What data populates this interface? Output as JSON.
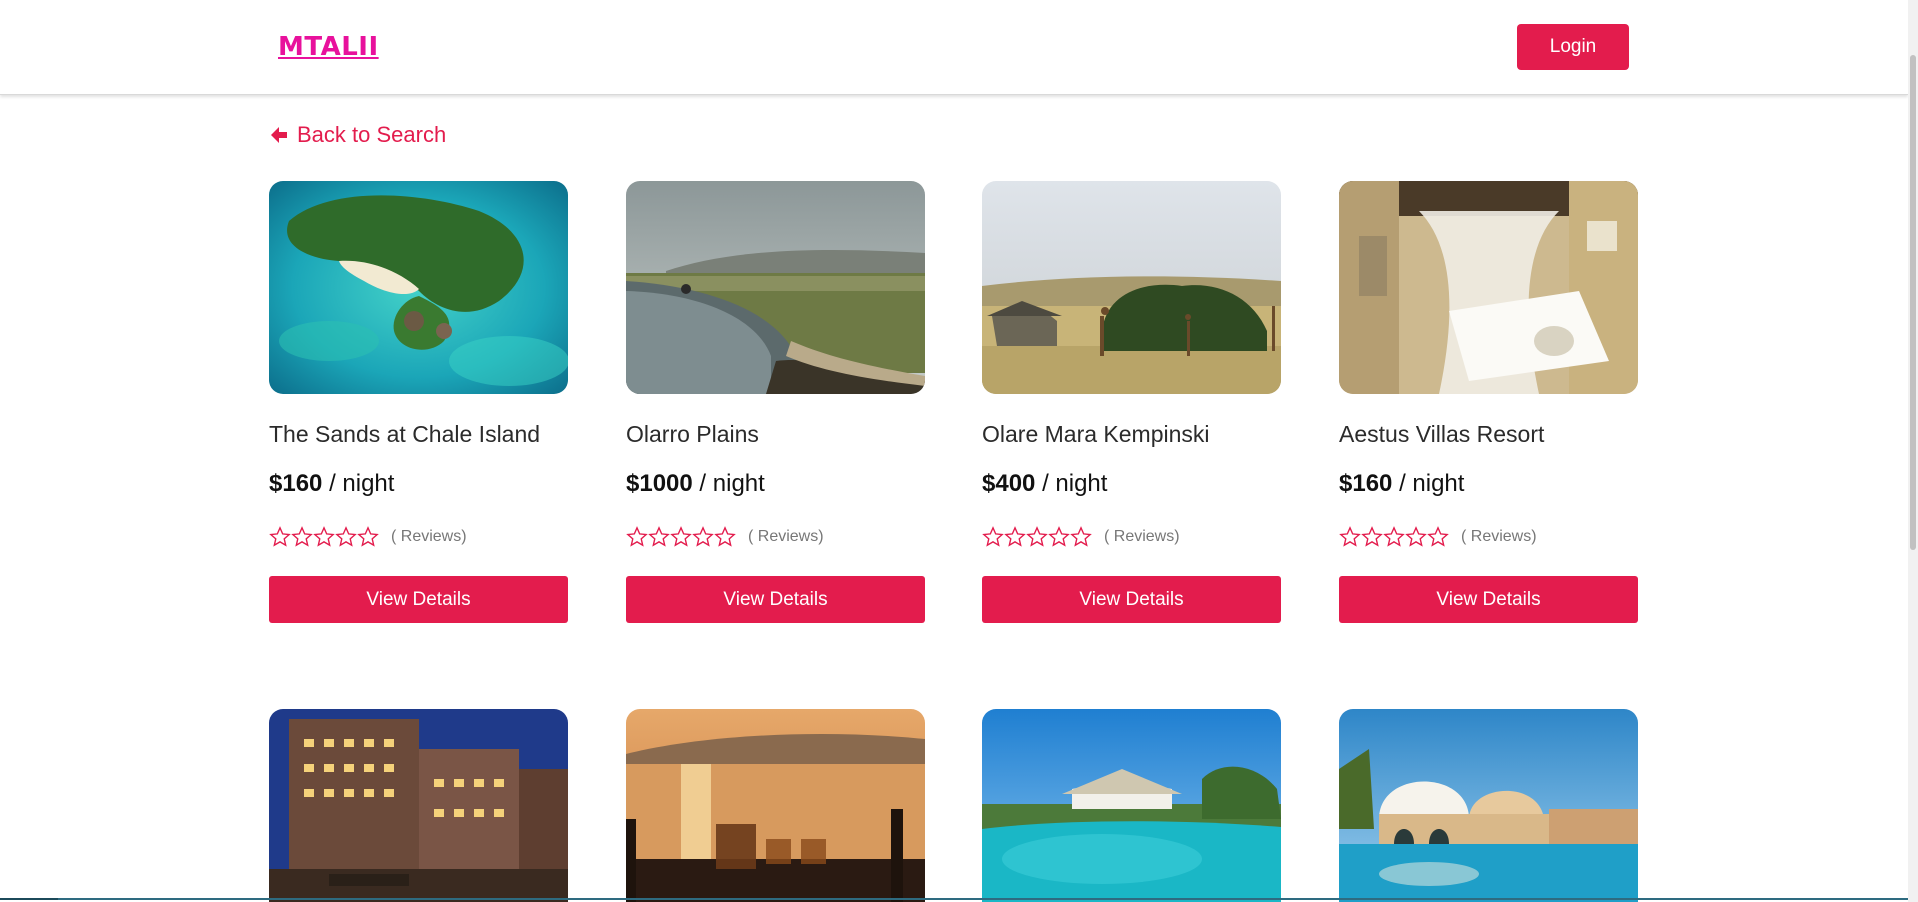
{
  "header": {
    "logo": "MTALII",
    "login_label": "Login"
  },
  "back_link": {
    "label": "Back to Search",
    "icon": "arrow-left-icon"
  },
  "colors": {
    "accent": "#e31c4d",
    "logo": "#e8119c"
  },
  "hotels": [
    {
      "name": "The Sands at Chale Island",
      "price": "$160",
      "per": "/ night",
      "reviews": "( Reviews)",
      "rating": 0,
      "button": "View Details",
      "image": "island-aerial"
    },
    {
      "name": "Olarro Plains",
      "price": "$1000",
      "per": "/ night",
      "reviews": "( Reviews)",
      "rating": 0,
      "button": "View Details",
      "image": "infinity-pool-savanna"
    },
    {
      "name": "Olare Mara Kempinski",
      "price": "$400",
      "per": "/ night",
      "reviews": "( Reviews)",
      "rating": 0,
      "button": "View Details",
      "image": "savanna-giraffes"
    },
    {
      "name": "Aestus Villas Resort",
      "price": "$160",
      "per": "/ night",
      "reviews": "( Reviews)",
      "rating": 0,
      "button": "View Details",
      "image": "bedroom-net"
    }
  ],
  "second_row_images": [
    "city-hotel-night",
    "sunset-tea",
    "resort-pool",
    "dome-villa-pool"
  ]
}
